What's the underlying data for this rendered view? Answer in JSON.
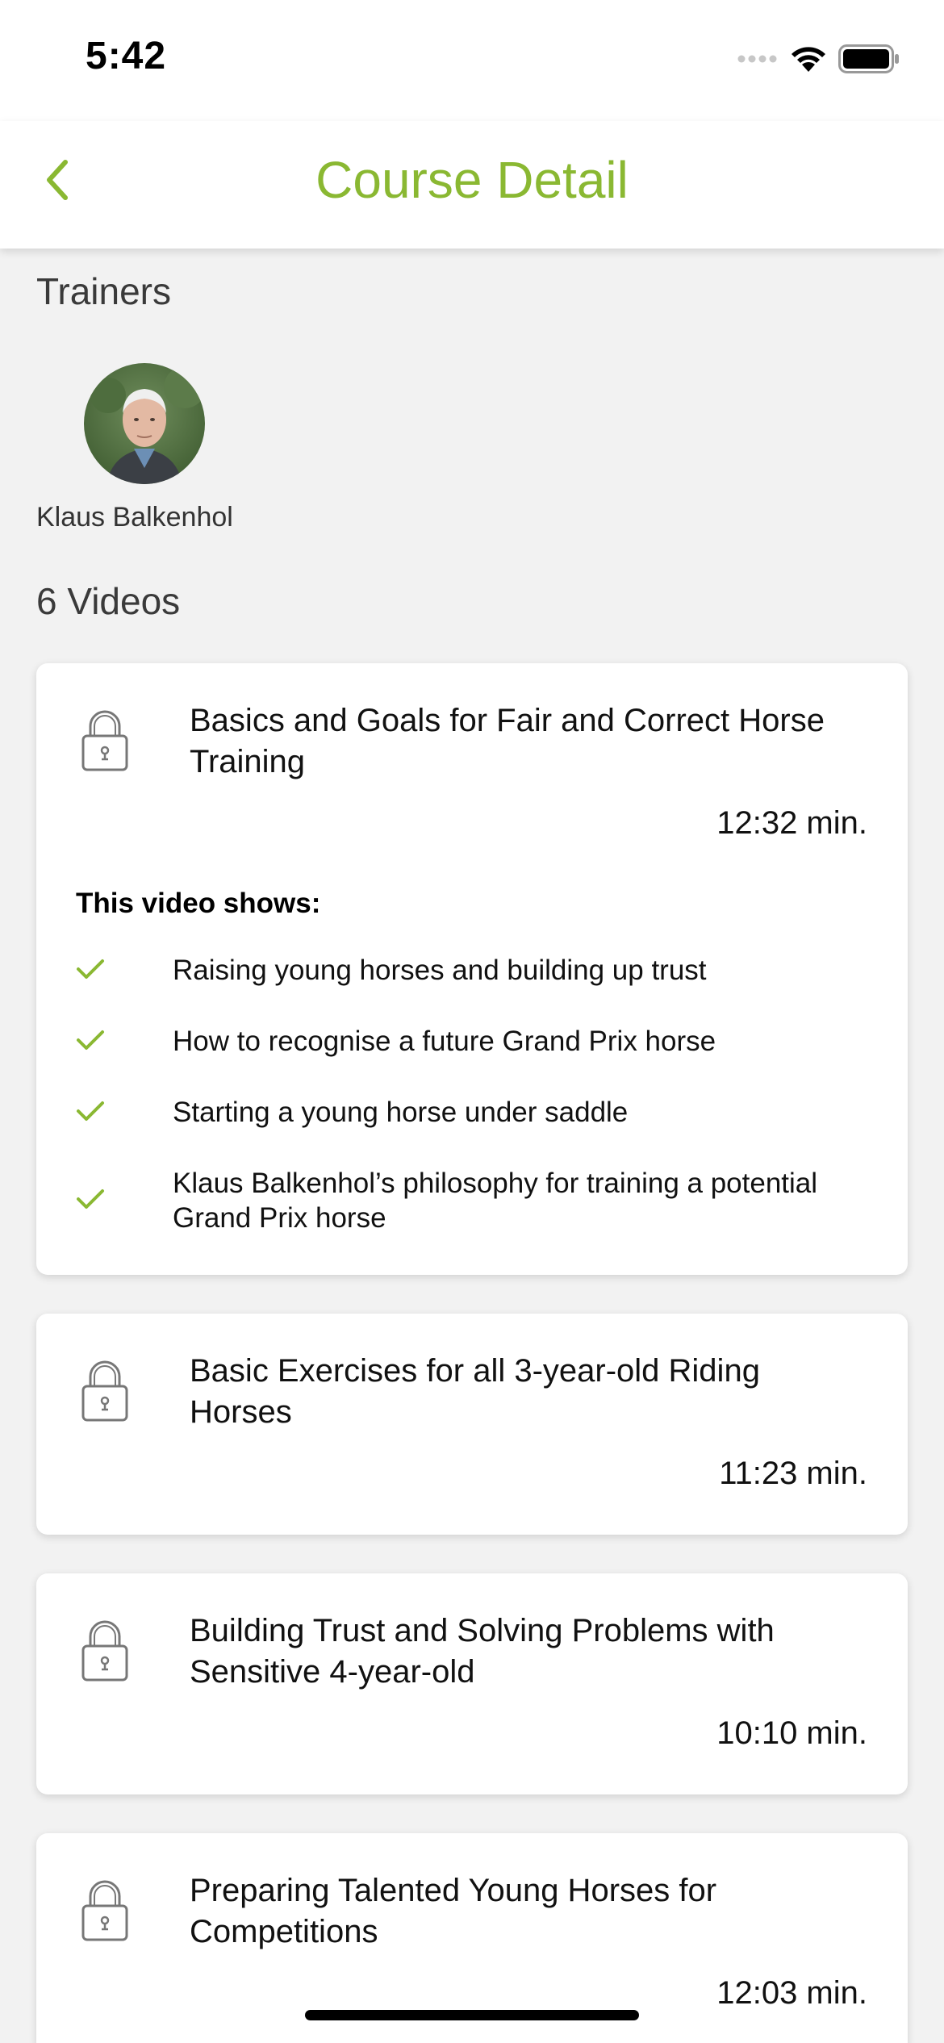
{
  "status_bar": {
    "time": "5:42"
  },
  "nav": {
    "title": "Course Detail",
    "accent_color": "#8ab832"
  },
  "trainers": {
    "heading": "Trainers",
    "items": [
      {
        "name": "Klaus Balkenhol"
      }
    ]
  },
  "videos": {
    "heading": "6 Videos",
    "items": [
      {
        "title": "Basics and Goals for Fair and Correct Horse Training",
        "duration": "12:32 min.",
        "locked": true,
        "shows_heading": "This video shows:",
        "bullets": [
          "Raising young horses and building up trust",
          "How to recognise a future Grand Prix horse",
          "Starting a young horse under saddle",
          "Klaus Balkenhol’s philosophy for training a potential Grand Prix horse"
        ]
      },
      {
        "title": "Basic Exercises for all 3-year-old Riding Horses",
        "duration": "11:23 min.",
        "locked": true
      },
      {
        "title": "Building Trust and Solving Problems with Sensitive 4-year-old",
        "duration": "10:10 min.",
        "locked": true
      },
      {
        "title": "Preparing Talented Young Horses for Competitions",
        "duration": "12:03 min.",
        "locked": true
      }
    ]
  },
  "icons": {
    "back": "chevron-left-icon",
    "lock": "lock-icon",
    "check": "checkmark-icon",
    "signal": "cellular-signal-icon",
    "wifi": "wifi-icon",
    "battery": "battery-icon"
  }
}
